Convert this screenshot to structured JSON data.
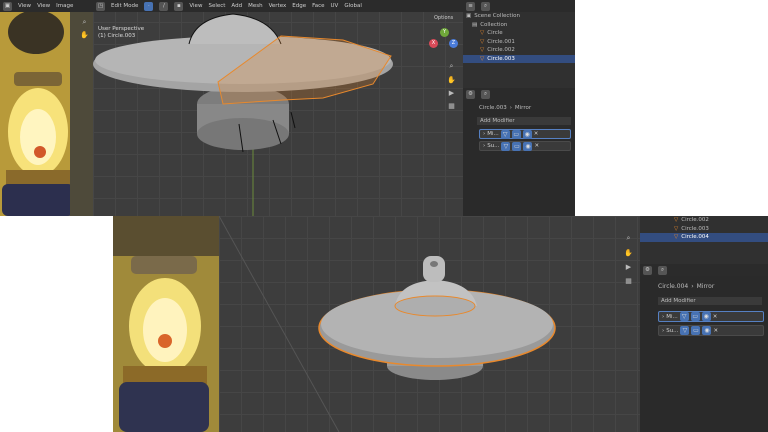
{
  "top": {
    "ref_menu": [
      "View",
      "View",
      "Image"
    ],
    "mode": "Edit Mode",
    "menu": [
      "View",
      "Select",
      "Add",
      "Mesh",
      "Vertex",
      "Edge",
      "Face",
      "UV"
    ],
    "orientation": "Global",
    "options": "Options",
    "viewport_label": "User Perspective",
    "viewport_object": "(1) Circle.003"
  },
  "outliner": {
    "title": "Scene Collection",
    "collection": "Collection",
    "items": [
      "Circle",
      "Circle.001",
      "Circle.002",
      "Circle.003"
    ]
  },
  "props_top": {
    "object": "Circle.003",
    "modifier": "Mirror",
    "add_modifier": "Add Modifier",
    "modifiers": [
      "Mi...",
      "Su..."
    ]
  },
  "outliner2": {
    "items": [
      "Circle.002",
      "Circle.003",
      "Circle.004"
    ]
  },
  "props_bottom": {
    "object": "Circle.004",
    "modifier": "Mirror",
    "add_modifier": "Add Modifier",
    "modifiers": [
      "Mi...",
      "Su..."
    ]
  },
  "colors": {
    "accent": "#4772b3",
    "selection": "#e8892d",
    "panel": "#303030",
    "viewport": "#3d3d3d"
  }
}
